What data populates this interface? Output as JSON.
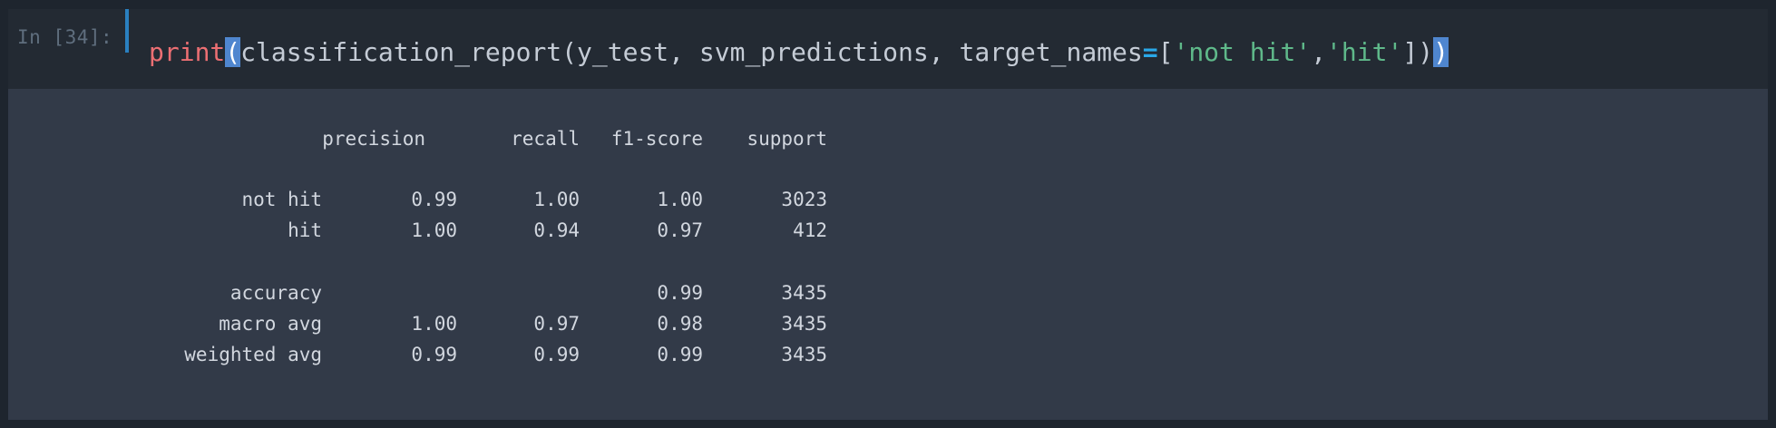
{
  "cell": {
    "prompt": "In [34]:",
    "code_tokens": [
      {
        "text": "print",
        "kind": "fn"
      },
      {
        "text": "(",
        "kind": "bracket-hl"
      },
      {
        "text": "classification_report(y_test, svm_predictions, target_names",
        "kind": "plain"
      },
      {
        "text": "=",
        "kind": "op"
      },
      {
        "text": "[",
        "kind": "plain"
      },
      {
        "text": "'not hit'",
        "kind": "str"
      },
      {
        "text": ",",
        "kind": "plain"
      },
      {
        "text": "'hit'",
        "kind": "str"
      },
      {
        "text": "])",
        "kind": "plain"
      },
      {
        "text": ")",
        "kind": "bracket-hl"
      }
    ]
  },
  "report": {
    "headers": {
      "precision": "precision",
      "recall": "recall",
      "f1": "f1-score",
      "support": "support"
    },
    "rows": [
      {
        "label": "not hit",
        "precision": "0.99",
        "recall": "1.00",
        "f1": "1.00",
        "support": "3023"
      },
      {
        "label": "hit",
        "precision": "1.00",
        "recall": "0.94",
        "f1": "0.97",
        "support": "412"
      },
      {
        "label": "accuracy",
        "precision": "",
        "recall": "",
        "f1": "0.99",
        "support": "3435"
      },
      {
        "label": "macro avg",
        "precision": "1.00",
        "recall": "0.97",
        "f1": "0.98",
        "support": "3435"
      },
      {
        "label": "weighted avg",
        "precision": "0.99",
        "recall": "0.99",
        "f1": "0.99",
        "support": "3435"
      }
    ]
  },
  "colors": {
    "background": "#1e252e",
    "input_bg": "#232a33",
    "output_bg": "#323a48",
    "function": "#ec6f73",
    "string": "#5fb98a",
    "operator": "#2aa8e8",
    "bracket_highlight": "#4f86cf"
  }
}
